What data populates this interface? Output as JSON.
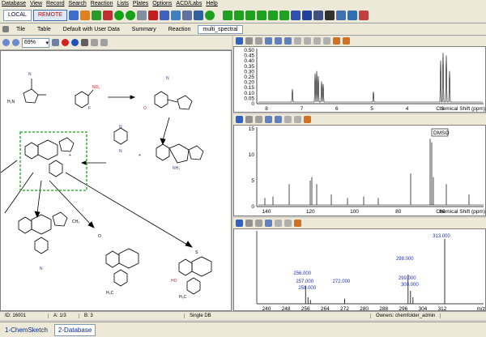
{
  "menu": [
    "Database",
    "View",
    "Record",
    "Search",
    "Reaction",
    "Lists",
    "Plates",
    "Options",
    "ACD/Labs",
    "Help"
  ],
  "toolbar": {
    "local_label": "LOCAL",
    "remote_label": "REMOTE"
  },
  "tabs": [
    "Tile",
    "Table",
    "Default with User Data",
    "Summary",
    "Reaction",
    "multi_spectral"
  ],
  "active_tab": "multi_spectral",
  "zoom": "69%",
  "spectra": [
    {
      "yticks": [
        "0.50",
        "0.45",
        "0.40",
        "0.35",
        "0.30",
        "0.25",
        "0.20",
        "0.15",
        "0.10",
        "0.05",
        "0"
      ],
      "xticks": [
        "8",
        "7",
        "6",
        "5",
        "4",
        "3"
      ],
      "xlabel": "Chemical Shift (ppm)"
    },
    {
      "yticks": [
        "15",
        "10",
        "5",
        "0"
      ],
      "xticks": [
        "140",
        "120",
        "100",
        "80",
        "60"
      ],
      "xlabel": "Chemical Shift (ppm)",
      "annotation": "DMSO"
    },
    {
      "xticks": [
        "240",
        "248",
        "256",
        "264",
        "272",
        "280",
        "288",
        "296",
        "304",
        "312"
      ],
      "xlabel": "m/z",
      "peak_labels": [
        "313.000",
        "298.000",
        "299.000",
        "300.000",
        "256.000",
        "257.000",
        "258.000",
        "272.000"
      ]
    }
  ],
  "status": {
    "id": "ID: 16001",
    "a": "A: 1/3",
    "b": "B: 3",
    "db": "Single DB",
    "owner": "Owners: chemfolder_admin"
  },
  "bottom_tabs": [
    "1-ChemSketch",
    "2-Database"
  ],
  "active_bottom_tab": "2-Database"
}
